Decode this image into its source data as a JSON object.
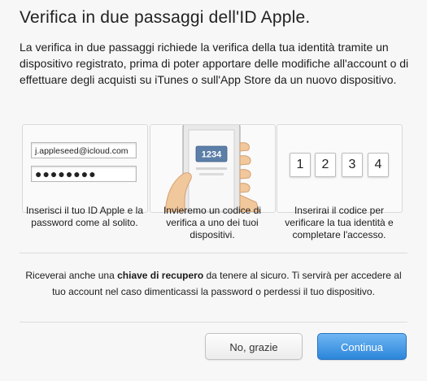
{
  "dialog": {
    "title": "Verifica in due passaggi dell'ID Apple.",
    "intro": "La verifica in due passaggi richiede la verifica della tua identità tramite un dispositivo registrato, prima di poter apportare delle modifiche all'account o di effettuare degli acquisti su iTunes o sull'App Store da un nuovo dispositivo."
  },
  "steps": [
    {
      "email_value": "j.appleseed@icloud.com",
      "password_value": "●●●●●●●●",
      "caption": "Inserisci il tuo ID Apple e la password come al solito."
    },
    {
      "phone_code": "1234",
      "caption": "Invieremo un codice di verifica a uno dei tuoi dispositivi."
    },
    {
      "code_digits": [
        "1",
        "2",
        "3",
        "4"
      ],
      "caption": "Inserirai il codice per verificare la tua identità e completare l'accesso."
    }
  ],
  "notice": {
    "before": "Riceverai anche una ",
    "bold": "chiave di recupero",
    "after": " da tenere al sicuro. Ti servirà per accedere al tuo account nel caso dimenticassi la password o perdessi il tuo dispositivo."
  },
  "buttons": {
    "cancel_label": "No, grazie",
    "continue_label": "Continua"
  },
  "colors": {
    "primary_button": "#2b86da",
    "phone_badge": "#5c7fa8",
    "hand_skin": "#f1c79c"
  }
}
